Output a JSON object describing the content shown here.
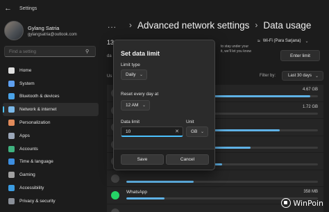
{
  "window": {
    "title": "Settings"
  },
  "user": {
    "name": "Gylang Satria",
    "email": "gylangsatria@outlook.com"
  },
  "search": {
    "placeholder": "Find a setting"
  },
  "nav": [
    {
      "label": "Home",
      "icon": "home-icon",
      "color": "#e0e0e0"
    },
    {
      "label": "System",
      "icon": "monitor-icon",
      "color": "#5ea0f0"
    },
    {
      "label": "Bluetooth & devices",
      "icon": "bluetooth-icon",
      "color": "#4aa3e8"
    },
    {
      "label": "Network & internet",
      "icon": "wifi-icon",
      "color": "#7ab8e8",
      "active": true
    },
    {
      "label": "Personalization",
      "icon": "brush-icon",
      "color": "#e08a5a"
    },
    {
      "label": "Apps",
      "icon": "apps-icon",
      "color": "#9aa6b8"
    },
    {
      "label": "Accounts",
      "icon": "person-icon",
      "color": "#3fb27f"
    },
    {
      "label": "Time & language",
      "icon": "globe-icon",
      "color": "#3d8ee0"
    },
    {
      "label": "Gaming",
      "icon": "gamepad-icon",
      "color": "#a0a0a0"
    },
    {
      "label": "Accessibility",
      "icon": "accessibility-icon",
      "color": "#3b9be0"
    },
    {
      "label": "Privacy & security",
      "icon": "shield-icon",
      "color": "#8a8f98"
    }
  ],
  "breadcrumb": {
    "more": "...",
    "parent": "Advanced network settings",
    "current": "Data usage"
  },
  "main": {
    "usage_fragment": "13",
    "usage_sub_fragment": "da",
    "usage_list_fragment": "Us",
    "note_line1": "to stay under your",
    "note_line2": "it, we'll let you know",
    "network": "Wi-Fi (Para Sarjana)",
    "enter_limit_label": "Enter limit",
    "filter_label": "Filter by:",
    "filter_value": "Last 30 days"
  },
  "apps": [
    {
      "name": "",
      "size": "4.67 GB",
      "fraction": 0.96,
      "icon": "app-icon",
      "color": "#444"
    },
    {
      "name": "",
      "size": "1.72 GB",
      "fraction": 0.37,
      "icon": "app-icon",
      "color": "#444"
    },
    {
      "name": "",
      "size": "",
      "fraction": 0.8,
      "icon": "app-icon",
      "color": "#444"
    },
    {
      "name": "",
      "size": "",
      "fraction": 0.65,
      "icon": "app-icon",
      "color": "#444"
    },
    {
      "name": "",
      "size": "",
      "fraction": 0.5,
      "icon": "app-icon",
      "color": "#444"
    },
    {
      "name": "",
      "size": "",
      "fraction": 0.35,
      "icon": "app-icon",
      "color": "#444"
    },
    {
      "name": "WhatsApp",
      "size": "358 MB",
      "fraction": 0.2,
      "icon": "whatsapp-icon",
      "color": "#25d366"
    },
    {
      "name": "",
      "size": "",
      "fraction": 0.15,
      "icon": "app-icon",
      "color": "#444"
    }
  ],
  "dialog": {
    "title": "Set data limit",
    "limit_type_label": "Limit type",
    "limit_type_value": "Daily",
    "reset_label": "Reset every day at",
    "reset_value": "12 AM",
    "data_limit_label": "Data limit",
    "data_limit_value": "10",
    "unit_label": "Unit",
    "unit_value": "GB",
    "save_label": "Save",
    "cancel_label": "Cancel"
  },
  "watermark": "WinPoin"
}
